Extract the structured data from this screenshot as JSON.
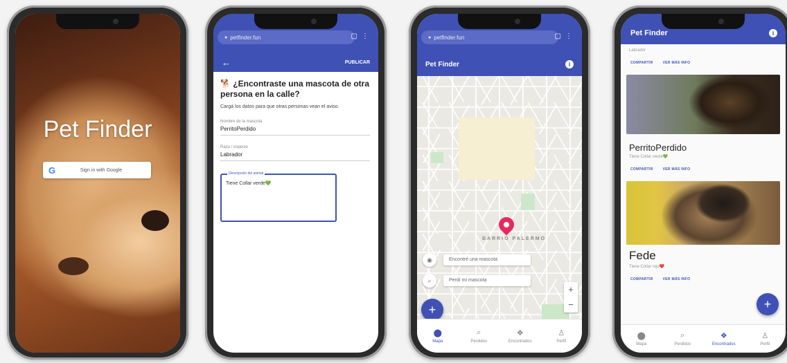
{
  "phone1": {
    "title": "Pet Finder",
    "google_button_label": "Sign in with Google"
  },
  "phone2": {
    "url": "petfinder.fun",
    "back_icon": "arrow-left-icon",
    "publish_label": "PUBLICAR",
    "question": "🐕 ¿Encontraste una mascota de otra persona en la calle?",
    "subtitle": "Cargá los datos para que otras personas vean el aviso.",
    "fields": [
      {
        "label": "Nombre de la mascota",
        "value": "PerritoPerdido"
      },
      {
        "label": "Raza / especie",
        "value": "Labrador"
      }
    ],
    "textarea_legend": "Descripción del animal",
    "textarea_value": "Tiene Collar verde💚"
  },
  "phone3": {
    "url": "petfinder.fun",
    "title": "Pet Finder",
    "map_label": "BARRIO PALERMO",
    "chip_found": "Encontré una mascota",
    "chip_lost": "Perdí mi mascota",
    "zoom_in": "+",
    "zoom_out": "−",
    "fab": "+",
    "nav": [
      {
        "icon": "pin-icon",
        "label": "Mapa",
        "active": true
      },
      {
        "icon": "search-icon",
        "label": "Perdidos",
        "active": false
      },
      {
        "icon": "pet-icon",
        "label": "Encontrados",
        "active": false
      },
      {
        "icon": "person-icon",
        "label": "Perfil",
        "active": false
      }
    ]
  },
  "phone4": {
    "title": "Pet Finder",
    "top_text": "Labrador",
    "share_label": "COMPARTIR",
    "more_label": "VER MÁS INFO",
    "cards": [
      {
        "name": "PerritoPerdido",
        "desc": "Tiene Collar verde💚"
      },
      {
        "name": "Fede",
        "desc": "Tiene Collar rojo❤️"
      }
    ],
    "fab": "+",
    "nav": [
      {
        "icon": "pin-icon",
        "label": "Mapa",
        "active": false
      },
      {
        "icon": "search-icon",
        "label": "Perdidos",
        "active": false
      },
      {
        "icon": "pet-icon",
        "label": "Encontrados",
        "active": true
      },
      {
        "icon": "person-icon",
        "label": "Perfil",
        "active": false
      }
    ]
  },
  "colors": {
    "primary": "#3f51b5",
    "pin": "#e8295f",
    "background": "#f3f3f3"
  }
}
